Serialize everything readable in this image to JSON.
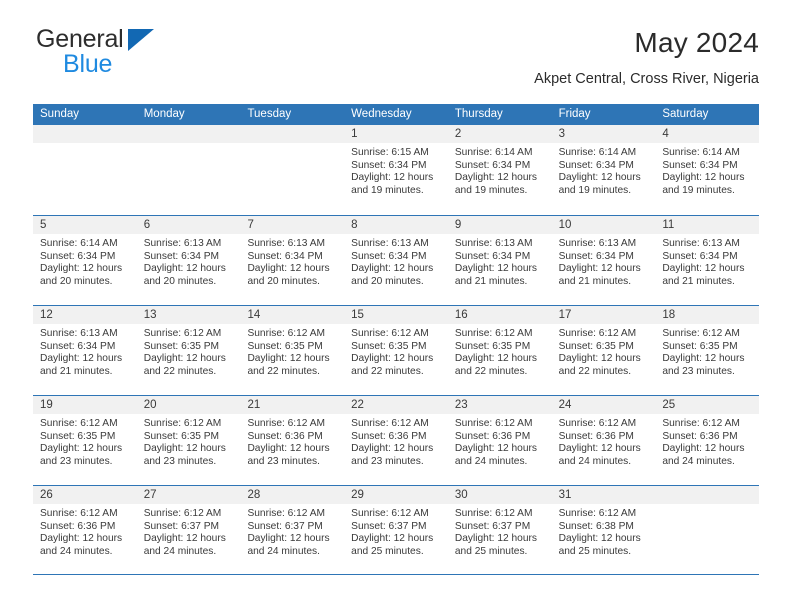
{
  "brand": {
    "name_top": "General",
    "name_bottom": "Blue",
    "triangle_color": "#1268b3",
    "blue_text_color": "#1f8ae0"
  },
  "header": {
    "title": "May 2024",
    "subtitle": "Akpet Central, Cross River, Nigeria"
  },
  "theme": {
    "header_blue": "#2e75b6",
    "date_strip_gray": "#f1f1f1",
    "text_color": "#3a3a3a"
  },
  "weekdays": [
    "Sunday",
    "Monday",
    "Tuesday",
    "Wednesday",
    "Thursday",
    "Friday",
    "Saturday"
  ],
  "labels": {
    "sunrise_prefix": "Sunrise: ",
    "sunset_prefix": "Sunset: ",
    "daylight_prefix": "Daylight: "
  },
  "weeks": [
    [
      {
        "date": "",
        "empty": true
      },
      {
        "date": "",
        "empty": true
      },
      {
        "date": "",
        "empty": true
      },
      {
        "date": "1",
        "sunrise": "Sunrise: 6:15 AM",
        "sunset": "Sunset: 6:34 PM",
        "daylight1": "Daylight: 12 hours",
        "daylight2": "and 19 minutes."
      },
      {
        "date": "2",
        "sunrise": "Sunrise: 6:14 AM",
        "sunset": "Sunset: 6:34 PM",
        "daylight1": "Daylight: 12 hours",
        "daylight2": "and 19 minutes."
      },
      {
        "date": "3",
        "sunrise": "Sunrise: 6:14 AM",
        "sunset": "Sunset: 6:34 PM",
        "daylight1": "Daylight: 12 hours",
        "daylight2": "and 19 minutes."
      },
      {
        "date": "4",
        "sunrise": "Sunrise: 6:14 AM",
        "sunset": "Sunset: 6:34 PM",
        "daylight1": "Daylight: 12 hours",
        "daylight2": "and 19 minutes."
      }
    ],
    [
      {
        "date": "5",
        "sunrise": "Sunrise: 6:14 AM",
        "sunset": "Sunset: 6:34 PM",
        "daylight1": "Daylight: 12 hours",
        "daylight2": "and 20 minutes."
      },
      {
        "date": "6",
        "sunrise": "Sunrise: 6:13 AM",
        "sunset": "Sunset: 6:34 PM",
        "daylight1": "Daylight: 12 hours",
        "daylight2": "and 20 minutes."
      },
      {
        "date": "7",
        "sunrise": "Sunrise: 6:13 AM",
        "sunset": "Sunset: 6:34 PM",
        "daylight1": "Daylight: 12 hours",
        "daylight2": "and 20 minutes."
      },
      {
        "date": "8",
        "sunrise": "Sunrise: 6:13 AM",
        "sunset": "Sunset: 6:34 PM",
        "daylight1": "Daylight: 12 hours",
        "daylight2": "and 20 minutes."
      },
      {
        "date": "9",
        "sunrise": "Sunrise: 6:13 AM",
        "sunset": "Sunset: 6:34 PM",
        "daylight1": "Daylight: 12 hours",
        "daylight2": "and 21 minutes."
      },
      {
        "date": "10",
        "sunrise": "Sunrise: 6:13 AM",
        "sunset": "Sunset: 6:34 PM",
        "daylight1": "Daylight: 12 hours",
        "daylight2": "and 21 minutes."
      },
      {
        "date": "11",
        "sunrise": "Sunrise: 6:13 AM",
        "sunset": "Sunset: 6:34 PM",
        "daylight1": "Daylight: 12 hours",
        "daylight2": "and 21 minutes."
      }
    ],
    [
      {
        "date": "12",
        "sunrise": "Sunrise: 6:13 AM",
        "sunset": "Sunset: 6:34 PM",
        "daylight1": "Daylight: 12 hours",
        "daylight2": "and 21 minutes."
      },
      {
        "date": "13",
        "sunrise": "Sunrise: 6:12 AM",
        "sunset": "Sunset: 6:35 PM",
        "daylight1": "Daylight: 12 hours",
        "daylight2": "and 22 minutes."
      },
      {
        "date": "14",
        "sunrise": "Sunrise: 6:12 AM",
        "sunset": "Sunset: 6:35 PM",
        "daylight1": "Daylight: 12 hours",
        "daylight2": "and 22 minutes."
      },
      {
        "date": "15",
        "sunrise": "Sunrise: 6:12 AM",
        "sunset": "Sunset: 6:35 PM",
        "daylight1": "Daylight: 12 hours",
        "daylight2": "and 22 minutes."
      },
      {
        "date": "16",
        "sunrise": "Sunrise: 6:12 AM",
        "sunset": "Sunset: 6:35 PM",
        "daylight1": "Daylight: 12 hours",
        "daylight2": "and 22 minutes."
      },
      {
        "date": "17",
        "sunrise": "Sunrise: 6:12 AM",
        "sunset": "Sunset: 6:35 PM",
        "daylight1": "Daylight: 12 hours",
        "daylight2": "and 22 minutes."
      },
      {
        "date": "18",
        "sunrise": "Sunrise: 6:12 AM",
        "sunset": "Sunset: 6:35 PM",
        "daylight1": "Daylight: 12 hours",
        "daylight2": "and 23 minutes."
      }
    ],
    [
      {
        "date": "19",
        "sunrise": "Sunrise: 6:12 AM",
        "sunset": "Sunset: 6:35 PM",
        "daylight1": "Daylight: 12 hours",
        "daylight2": "and 23 minutes."
      },
      {
        "date": "20",
        "sunrise": "Sunrise: 6:12 AM",
        "sunset": "Sunset: 6:35 PM",
        "daylight1": "Daylight: 12 hours",
        "daylight2": "and 23 minutes."
      },
      {
        "date": "21",
        "sunrise": "Sunrise: 6:12 AM",
        "sunset": "Sunset: 6:36 PM",
        "daylight1": "Daylight: 12 hours",
        "daylight2": "and 23 minutes."
      },
      {
        "date": "22",
        "sunrise": "Sunrise: 6:12 AM",
        "sunset": "Sunset: 6:36 PM",
        "daylight1": "Daylight: 12 hours",
        "daylight2": "and 23 minutes."
      },
      {
        "date": "23",
        "sunrise": "Sunrise: 6:12 AM",
        "sunset": "Sunset: 6:36 PM",
        "daylight1": "Daylight: 12 hours",
        "daylight2": "and 24 minutes."
      },
      {
        "date": "24",
        "sunrise": "Sunrise: 6:12 AM",
        "sunset": "Sunset: 6:36 PM",
        "daylight1": "Daylight: 12 hours",
        "daylight2": "and 24 minutes."
      },
      {
        "date": "25",
        "sunrise": "Sunrise: 6:12 AM",
        "sunset": "Sunset: 6:36 PM",
        "daylight1": "Daylight: 12 hours",
        "daylight2": "and 24 minutes."
      }
    ],
    [
      {
        "date": "26",
        "sunrise": "Sunrise: 6:12 AM",
        "sunset": "Sunset: 6:36 PM",
        "daylight1": "Daylight: 12 hours",
        "daylight2": "and 24 minutes."
      },
      {
        "date": "27",
        "sunrise": "Sunrise: 6:12 AM",
        "sunset": "Sunset: 6:37 PM",
        "daylight1": "Daylight: 12 hours",
        "daylight2": "and 24 minutes."
      },
      {
        "date": "28",
        "sunrise": "Sunrise: 6:12 AM",
        "sunset": "Sunset: 6:37 PM",
        "daylight1": "Daylight: 12 hours",
        "daylight2": "and 24 minutes."
      },
      {
        "date": "29",
        "sunrise": "Sunrise: 6:12 AM",
        "sunset": "Sunset: 6:37 PM",
        "daylight1": "Daylight: 12 hours",
        "daylight2": "and 25 minutes."
      },
      {
        "date": "30",
        "sunrise": "Sunrise: 6:12 AM",
        "sunset": "Sunset: 6:37 PM",
        "daylight1": "Daylight: 12 hours",
        "daylight2": "and 25 minutes."
      },
      {
        "date": "31",
        "sunrise": "Sunrise: 6:12 AM",
        "sunset": "Sunset: 6:38 PM",
        "daylight1": "Daylight: 12 hours",
        "daylight2": "and 25 minutes."
      },
      {
        "date": "",
        "empty": true
      }
    ]
  ]
}
